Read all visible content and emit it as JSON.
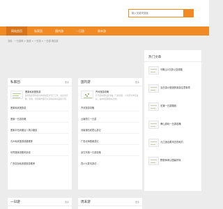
{
  "search": {
    "placeholder": "输入关键词搜索"
  },
  "nav": [
    "网站首页",
    "私家团",
    "国内游",
    "一日游",
    "周末游"
  ],
  "breadcrumb": "当前：一日游网 > 旅游 > 一日游 > 一日游 周边游",
  "cards": {
    "private": {
      "title": "私家团",
      "more": "更多",
      "featured": {
        "title": "蓬莱私家团旅游",
        "desc": "蓬莱私家团旅游全体游客经过专门工作，在注重行程、游客、费用等方面可以获得多种高品质享受。"
      },
      "items": [
        "蓬莱私家团旅游",
        "蓬莱一日游攻略",
        "蓬莱半岛到烟台八角口路线",
        "青州私家团游线路推荐",
        "世界蓬莱宫殿风景线",
        "广西百色私家团旅游推荐"
      ]
    },
    "domestic": {
      "title": "国内游",
      "more": "更多",
      "featured": {
        "title": "齐河旅游攻略",
        "desc": "齐河县地理位置优越，气候温和，人文风光丰富多彩，是休闲度假的好去处。"
      },
      "items": [
        "齐河旅游攻略",
        "云南丽江一日游",
        "河南洛阳老君山游记",
        "广西北海银滩游记",
        "武汉东湖一日游攻略",
        "四川九寨沟游记"
      ]
    },
    "oneday": {
      "title": "一日游",
      "more": "更多"
    },
    "weekend": {
      "title": "周末游",
      "more": "更多"
    }
  },
  "sidebar": {
    "title": "热门文章",
    "items": [
      "马鞍山1日游公交线路",
      "当日游小型团的旅游注意事项",
      "无锡一日游路线",
      "黄山游玩一日游攻略",
      "九江适合周末去的地方",
      "野营休闲公园最好玩"
    ]
  }
}
